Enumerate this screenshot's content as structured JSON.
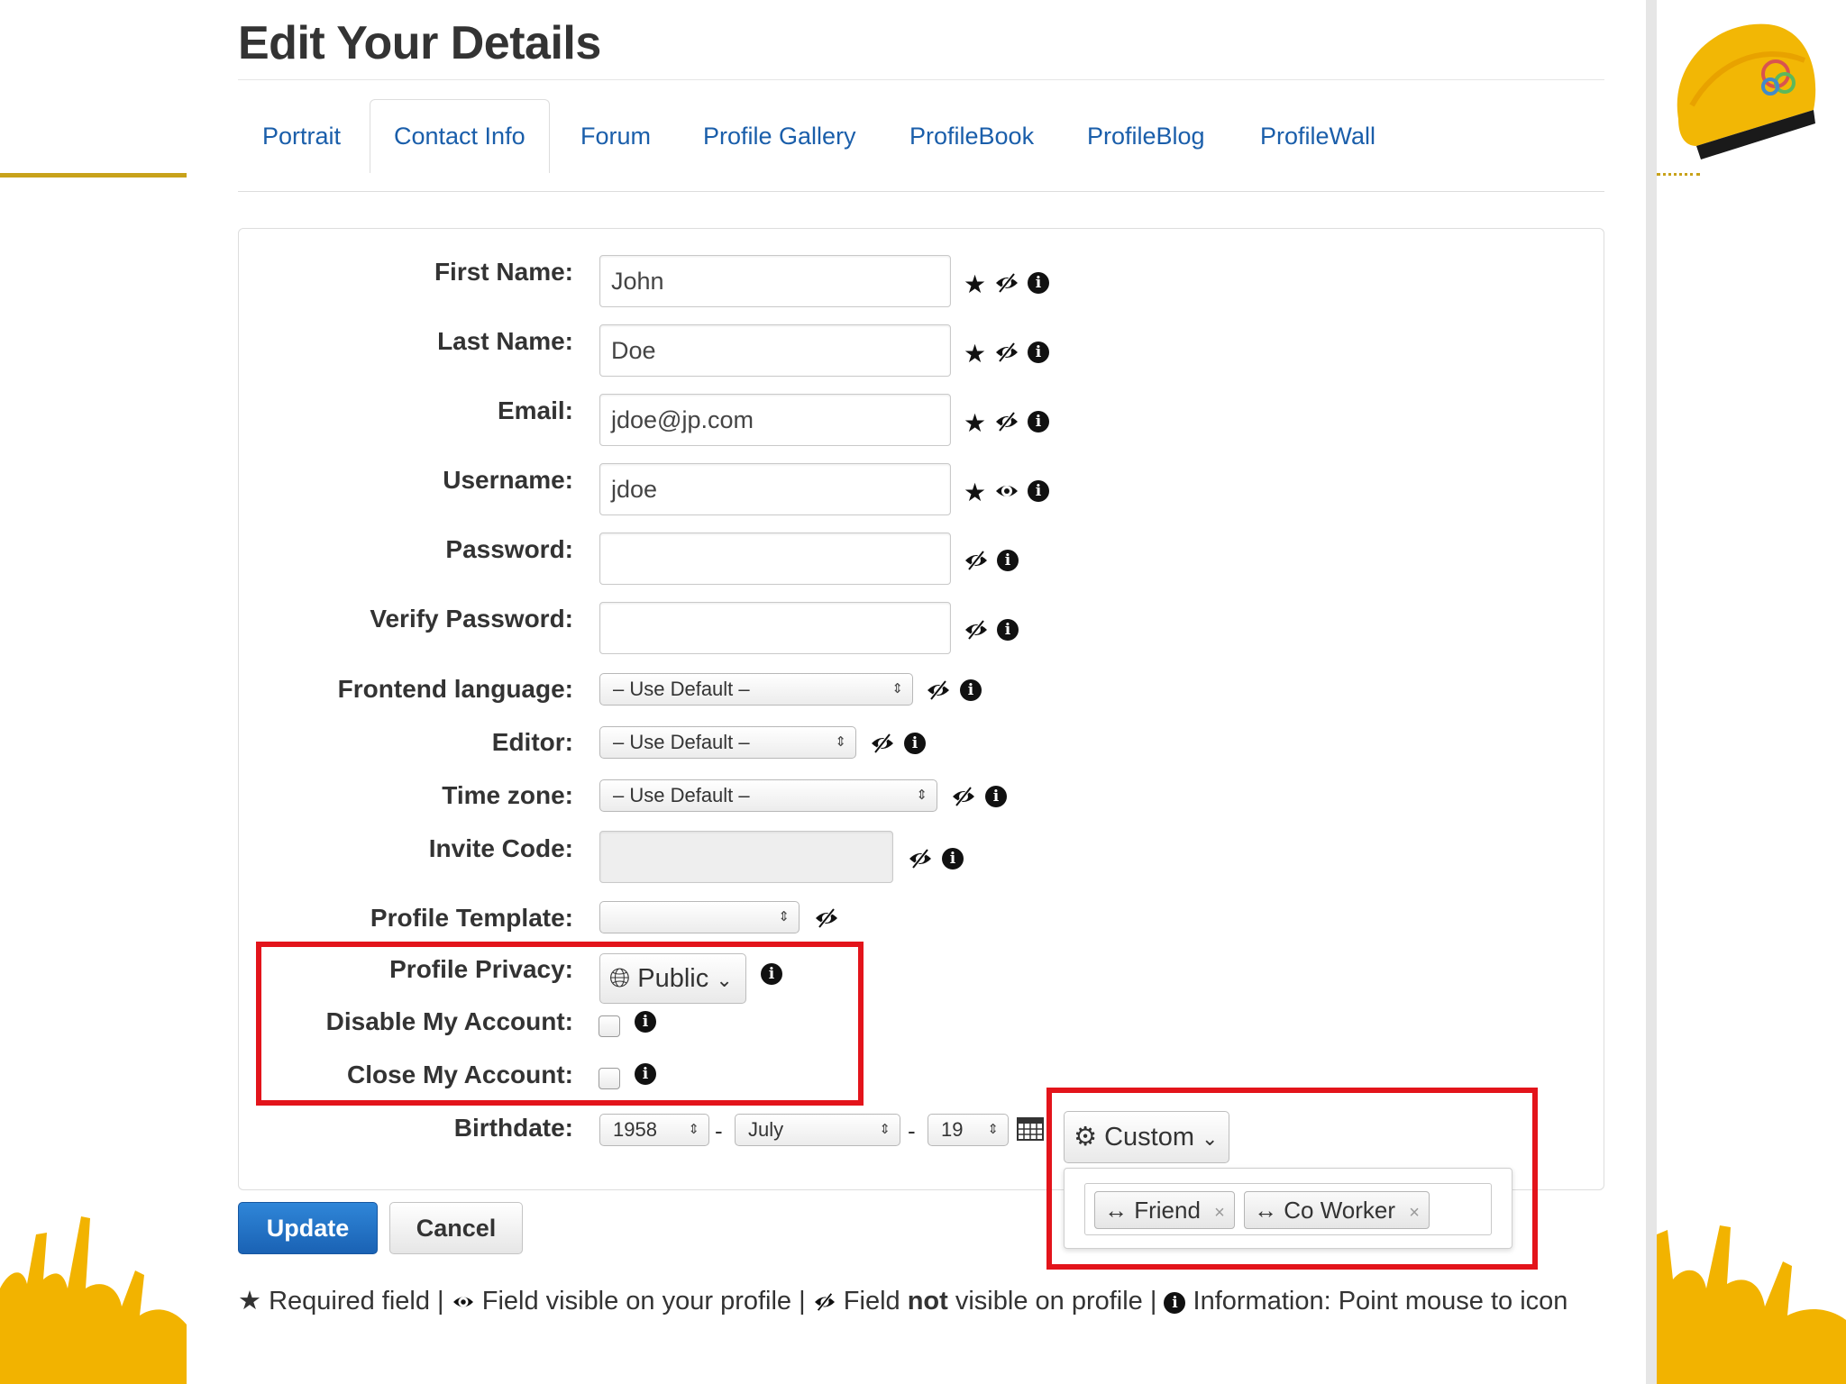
{
  "page": {
    "title": "Edit Your Details"
  },
  "tabs": [
    {
      "label": "Portrait"
    },
    {
      "label": "Contact Info"
    },
    {
      "label": "Forum"
    },
    {
      "label": "Profile Gallery"
    },
    {
      "label": "ProfileBook"
    },
    {
      "label": "ProfileBlog"
    },
    {
      "label": "ProfileWall"
    }
  ],
  "active_tab": "Contact Info",
  "fields": {
    "first_name": {
      "label": "First Name:",
      "value": "John"
    },
    "last_name": {
      "label": "Last Name:",
      "value": "Doe"
    },
    "email": {
      "label": "Email:",
      "value": "jdoe@jp.com"
    },
    "username": {
      "label": "Username:",
      "value": "jdoe"
    },
    "password": {
      "label": "Password:",
      "value": ""
    },
    "verify_password": {
      "label": "Verify Password:",
      "value": ""
    },
    "frontend_language": {
      "label": "Frontend language:",
      "value": "– Use Default –"
    },
    "editor": {
      "label": "Editor:",
      "value": "– Use Default –"
    },
    "time_zone": {
      "label": "Time zone:",
      "value": "– Use Default –"
    },
    "invite_code": {
      "label": "Invite Code:",
      "value": ""
    },
    "profile_template": {
      "label": "Profile Template:",
      "value": ""
    },
    "profile_privacy": {
      "label": "Profile Privacy:",
      "value": "Public"
    },
    "disable_account": {
      "label": "Disable My Account:",
      "checked": false
    },
    "close_account": {
      "label": "Close My Account:",
      "checked": false
    },
    "birthdate": {
      "label": "Birthdate:",
      "year": "1958",
      "month": "July",
      "day": "19",
      "separator": "-"
    }
  },
  "birthdate_visibility": {
    "button_label": "Custom",
    "selected": [
      {
        "label": "Friend"
      },
      {
        "label": "Co Worker"
      }
    ],
    "remove_glyph": "×",
    "chip_glyph": "↔"
  },
  "buttons": {
    "update": "Update",
    "cancel": "Cancel"
  },
  "legend": {
    "required": "Required field |",
    "visible": "Field visible on your profile |",
    "not_prefix": "Field",
    "not_bold": "not",
    "not_suffix": "visible on profile |",
    "info": "Information: Point mouse to icon"
  },
  "colors": {
    "accent_link": "#1a5eaa",
    "update_button": "#1a62b4",
    "highlight_box": "#e3141b",
    "brand_gold": "#c8a21a"
  },
  "icons": {
    "required": "star-icon",
    "hidden": "eye-slash-icon",
    "visible": "eye-icon",
    "info": "info-icon",
    "privacy": "globe-icon",
    "custom": "gear-icon",
    "calendar": "calendar-icon"
  }
}
